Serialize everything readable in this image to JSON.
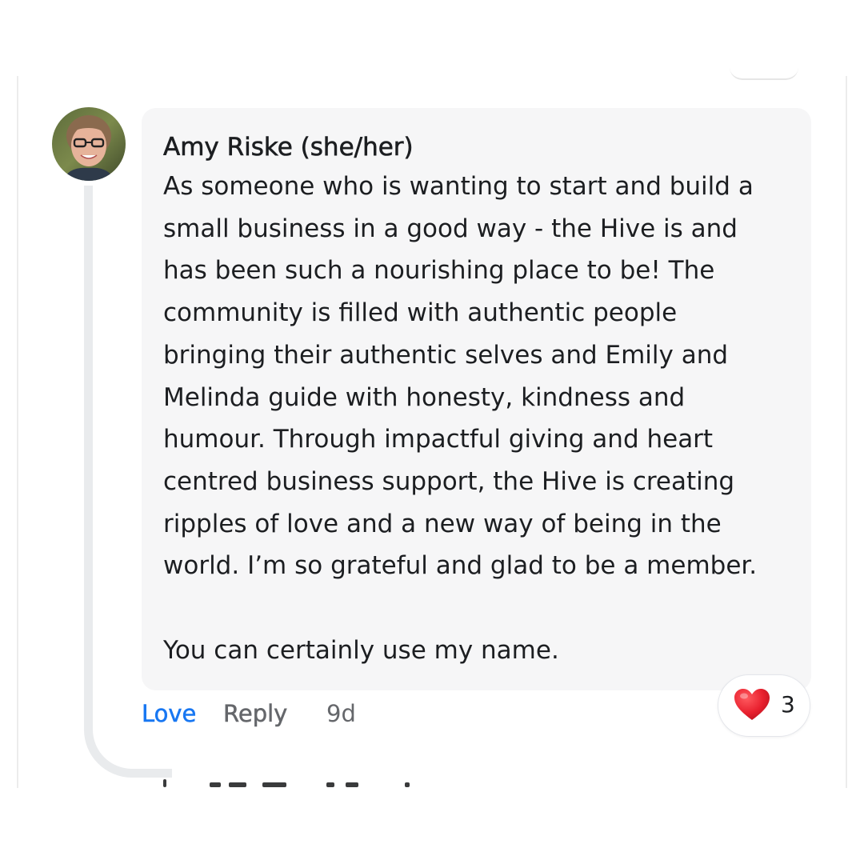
{
  "comment": {
    "author": "Amy Riske (she/her)",
    "body_lines": [
      "As someone who is wanting to start and build a",
      "small business in a good way - the Hive is and",
      "has been such a nourishing place to be! The",
      "community is filled with authentic people",
      "bringing their authentic selves and Emily and",
      "Melinda guide with honesty, kindness and",
      "humour. Through impactful giving and heart",
      "centred business support, the Hive is creating",
      "ripples of love and a new way of being in the",
      "world. I’m so grateful and glad to be a member."
    ],
    "closing_line": "You can certainly use my name.",
    "avatar_icon": "profile-photo",
    "actions": {
      "love_label": "Love",
      "reply_label": "Reply",
      "timestamp": "9d"
    },
    "reaction": {
      "icon": "red-heart-icon",
      "count": "3"
    }
  },
  "colors": {
    "bubble_bg": "#f6f6f7",
    "text": "#1c1e21",
    "love_active": "#1877f2",
    "secondary_text": "#65676b",
    "thread_line": "#e9ebed",
    "heart": "#e8202e"
  }
}
